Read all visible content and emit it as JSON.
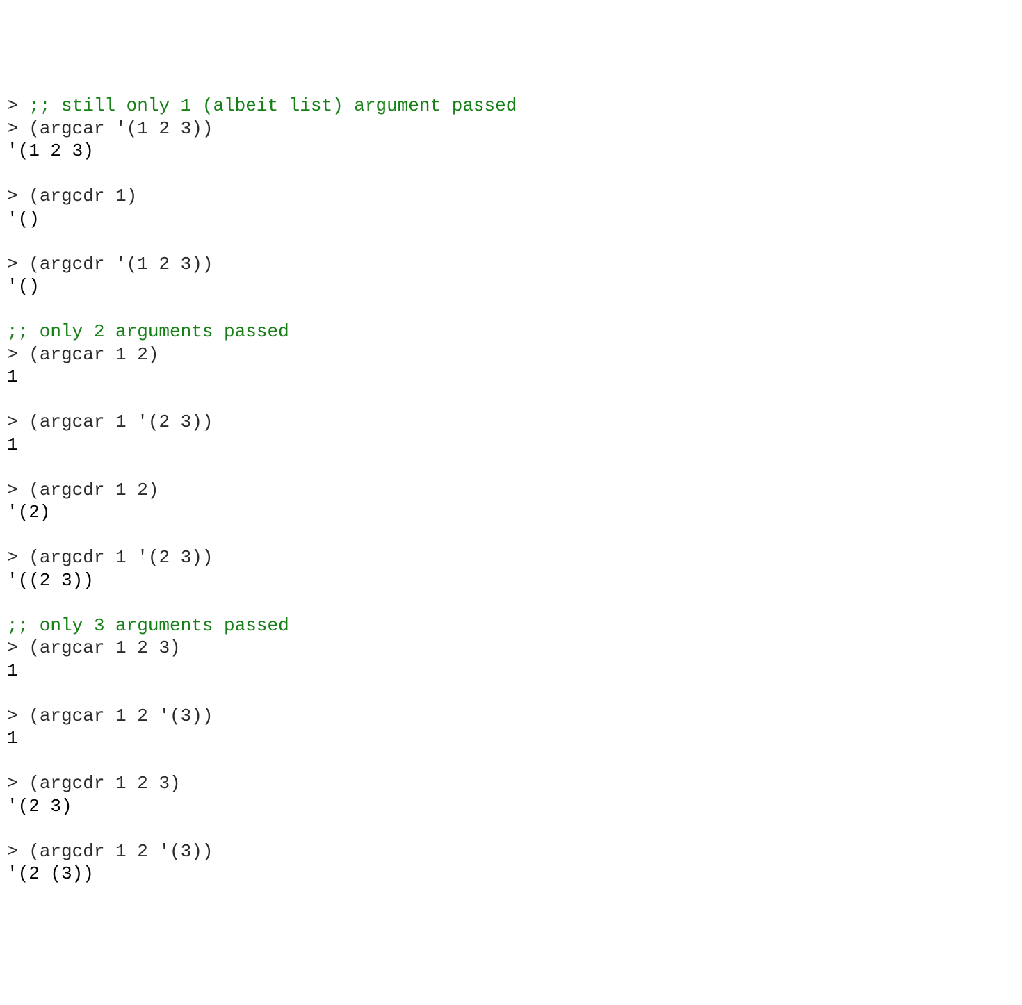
{
  "lines": [
    {
      "kind": "input-comment",
      "prompt": "> ",
      "comment": ";; still only 1 (albeit list) argument passed"
    },
    {
      "kind": "input",
      "prompt": "> ",
      "code": "(argcar '(1 2 3))"
    },
    {
      "kind": "result",
      "text": "'(1 2 3)"
    },
    {
      "kind": "blank"
    },
    {
      "kind": "input",
      "prompt": "> ",
      "code": "(argcdr 1)"
    },
    {
      "kind": "result",
      "text": "'()"
    },
    {
      "kind": "blank"
    },
    {
      "kind": "input",
      "prompt": "> ",
      "code": "(argcdr '(1 2 3))"
    },
    {
      "kind": "result",
      "text": "'()"
    },
    {
      "kind": "blank"
    },
    {
      "kind": "comment",
      "comment": ";; only 2 arguments passed"
    },
    {
      "kind": "input",
      "prompt": "> ",
      "code": "(argcar 1 2)"
    },
    {
      "kind": "result",
      "text": "1"
    },
    {
      "kind": "blank"
    },
    {
      "kind": "input",
      "prompt": "> ",
      "code": "(argcar 1 '(2 3))"
    },
    {
      "kind": "result",
      "text": "1"
    },
    {
      "kind": "blank"
    },
    {
      "kind": "input",
      "prompt": "> ",
      "code": "(argcdr 1 2)"
    },
    {
      "kind": "result",
      "text": "'(2)"
    },
    {
      "kind": "blank"
    },
    {
      "kind": "input",
      "prompt": "> ",
      "code": "(argcdr 1 '(2 3))"
    },
    {
      "kind": "result",
      "text": "'((2 3))"
    },
    {
      "kind": "blank"
    },
    {
      "kind": "comment",
      "comment": ";; only 3 arguments passed"
    },
    {
      "kind": "input",
      "prompt": "> ",
      "code": "(argcar 1 2 3)"
    },
    {
      "kind": "result",
      "text": "1"
    },
    {
      "kind": "blank"
    },
    {
      "kind": "input",
      "prompt": "> ",
      "code": "(argcar 1 2 '(3))"
    },
    {
      "kind": "result",
      "text": "1"
    },
    {
      "kind": "blank"
    },
    {
      "kind": "input",
      "prompt": "> ",
      "code": "(argcdr 1 2 3)"
    },
    {
      "kind": "result",
      "text": "'(2 3)"
    },
    {
      "kind": "blank"
    },
    {
      "kind": "input",
      "prompt": "> ",
      "code": "(argcdr 1 2 '(3))"
    },
    {
      "kind": "result",
      "text": "'(2 (3))"
    }
  ]
}
